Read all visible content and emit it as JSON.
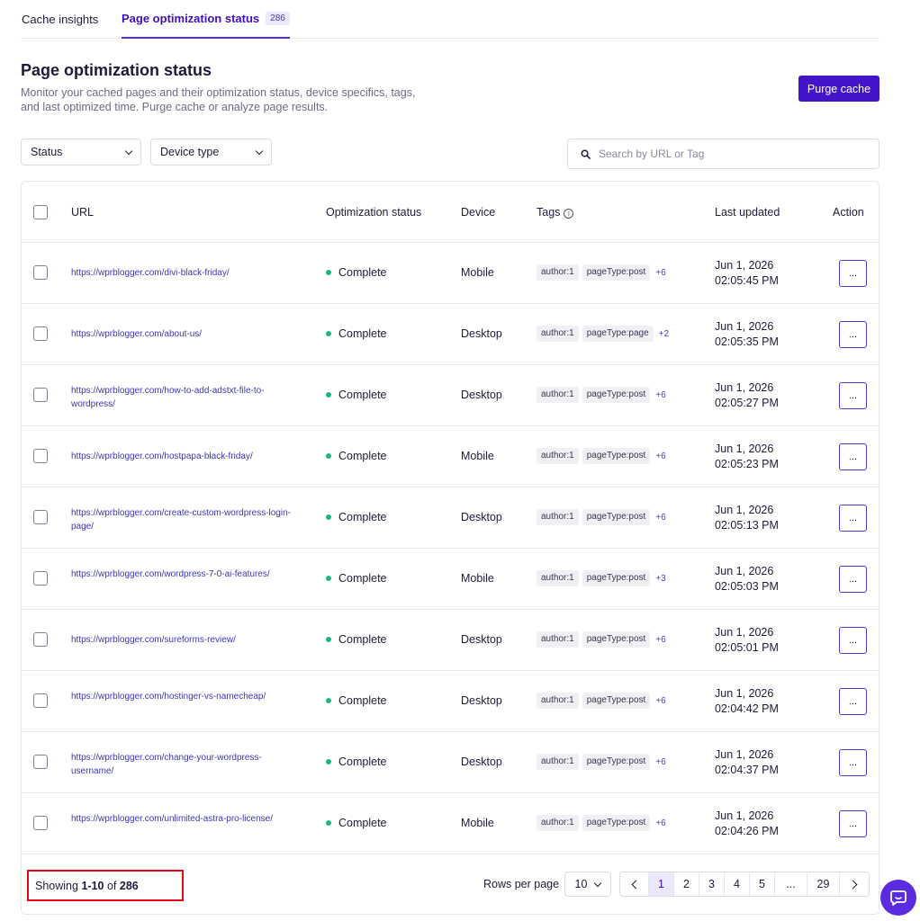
{
  "tabs": [
    {
      "label": "Cache insights"
    },
    {
      "label": "Page optimization status",
      "count": "286"
    }
  ],
  "header": {
    "title": "Page optimization status",
    "description": "Monitor your cached pages and their optimization status, device specifics, tags, and last optimized time. Purge cache or analyze page results.",
    "purge_label": "Purge cache"
  },
  "filters": {
    "status_label": "Status",
    "device_label": "Device type",
    "search_placeholder": "Search by URL or Tag"
  },
  "table": {
    "columns": {
      "url": "URL",
      "status": "Optimization status",
      "device": "Device",
      "tags": "Tags",
      "updated": "Last updated",
      "action": "Action"
    },
    "rows": [
      {
        "url": "https://wprblogger.com/divi-black-friday/",
        "status": "Complete",
        "device": "Mobile",
        "tag1": "author:1",
        "tag2": "pageType:post",
        "more": "+6",
        "date": "Jun 1, 2026",
        "time": "02:05:45 PM"
      },
      {
        "url": "https://wprblogger.com/about-us/",
        "status": "Complete",
        "device": "Desktop",
        "tag1": "author:1",
        "tag2": "pageType:page",
        "more": "+2",
        "date": "Jun 1, 2026",
        "time": "02:05:35 PM"
      },
      {
        "url": "https://wprblogger.com/how-to-add-adstxt-file-to-wordpress/",
        "status": "Complete",
        "device": "Desktop",
        "tag1": "author:1",
        "tag2": "pageType:post",
        "more": "+6",
        "date": "Jun 1, 2026",
        "time": "02:05:27 PM"
      },
      {
        "url": "https://wprblogger.com/hostpapa-black-friday/",
        "status": "Complete",
        "device": "Mobile",
        "tag1": "author:1",
        "tag2": "pageType:post",
        "more": "+6",
        "date": "Jun 1, 2026",
        "time": "02:05:23 PM"
      },
      {
        "url": "https://wprblogger.com/create-custom-wordpress-login-page/",
        "status": "Complete",
        "device": "Desktop",
        "tag1": "author:1",
        "tag2": "pageType:post",
        "more": "+6",
        "date": "Jun 1, 2026",
        "time": "02:05:13 PM"
      },
      {
        "url": "https://wprblogger.com/wordpress-7-0-ai-features/",
        "status": "Complete",
        "device": "Mobile",
        "tag1": "author:1",
        "tag2": "pageType:post",
        "more": "+3",
        "date": "Jun 1, 2026",
        "time": "02:05:03 PM"
      },
      {
        "url": "https://wprblogger.com/sureforms-review/",
        "status": "Complete",
        "device": "Desktop",
        "tag1": "author:1",
        "tag2": "pageType:post",
        "more": "+6",
        "date": "Jun 1, 2026",
        "time": "02:05:01 PM"
      },
      {
        "url": "https://wprblogger.com/hostinger-vs-namecheap/",
        "status": "Complete",
        "device": "Desktop",
        "tag1": "author:1",
        "tag2": "pageType:post",
        "more": "+6",
        "date": "Jun 1, 2026",
        "time": "02:04:42 PM"
      },
      {
        "url": "https://wprblogger.com/change-your-wordpress-username/",
        "status": "Complete",
        "device": "Desktop",
        "tag1": "author:1",
        "tag2": "pageType:post",
        "more": "+6",
        "date": "Jun 1, 2026",
        "time": "02:04:37 PM"
      },
      {
        "url": "https://wprblogger.com/unlimited-astra-pro-license/",
        "status": "Complete",
        "device": "Mobile",
        "tag1": "author:1",
        "tag2": "pageType:post",
        "more": "+6",
        "date": "Jun 1, 2026",
        "time": "02:04:26 PM"
      }
    ],
    "action_label": "..."
  },
  "footer": {
    "showing_prefix": "Showing",
    "showing_range": "1-10",
    "showing_of": "of",
    "showing_total": "286",
    "rows_per_page_label": "Rows per page",
    "rows_per_page_value": "10",
    "pages": [
      "1",
      "2",
      "3",
      "4",
      "5",
      "...",
      "29"
    ],
    "active_page": "1"
  },
  "icons": {
    "search": "search-icon",
    "info": "info-icon",
    "chat": "chat-icon",
    "prev": "chevron-left-icon",
    "next": "chevron-right-icon"
  },
  "colors": {
    "accent": "#4314c8",
    "status_complete": "#1bb68a",
    "highlight_box": "#e4061a"
  }
}
